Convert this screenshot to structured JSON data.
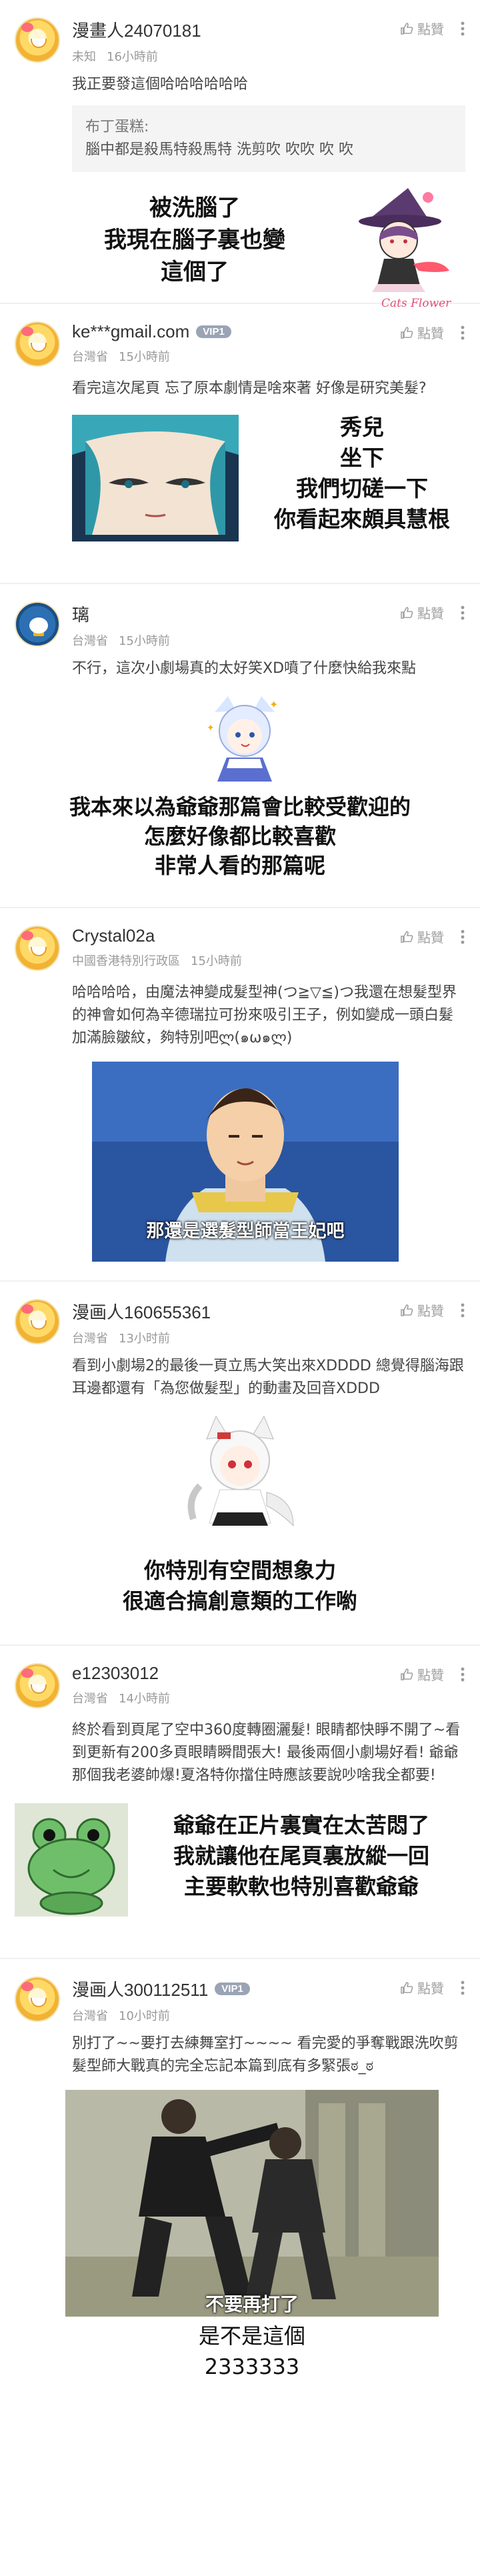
{
  "comments": [
    {
      "username": "漫畫人24070181",
      "vip": "",
      "location": "未知",
      "time": "16小時前",
      "like_label": "點贊",
      "text": "我正要發這個哈哈哈哈哈哈",
      "quote_author": "布丁蛋糕:",
      "quote_text": "腦中都是殺馬特殺馬特 洗剪吹 吹吹 吹 吹",
      "meme_caption": "被洗腦了\n我現在腦子裏也變\n這個了",
      "meme_watermark": "Cats Flower"
    },
    {
      "username": "ke***gmail.com",
      "vip": "VIP1",
      "location": "台灣省",
      "time": "15小時前",
      "like_label": "點贊",
      "text": "看完這次尾頁 忘了原本劇情是啥來著 好像是研究美髮?",
      "meme_caption": "秀兒\n坐下\n我們切磋一下\n你看起來頗具慧根"
    },
    {
      "username": "璃",
      "vip": "",
      "location": "台灣省",
      "time": "15小時前",
      "like_label": "點贊",
      "text": "不行，這次小劇場真的太好笑XD噴了什麼快給我來點",
      "meme_caption": "我本來以為爺爺那篇會比較受歡迎的\n怎麼好像都比較喜歡\n非常人看的那篇呢"
    },
    {
      "username": "Crystal02a",
      "vip": "",
      "location": "中國香港特別行政區",
      "time": "15小時前",
      "like_label": "點贊",
      "text": "哈哈哈哈，由魔法神變成髮型神(つ≧▽≦)つ我還在想髮型界的神會如何為辛德瑞拉可扮來吸引王子，例如變成一頭白髮加滿臉皺紋，夠特別吧ლ(๑ω๑ლ)",
      "meme_caption": "那還是選髮型師當王妃吧"
    },
    {
      "username": "漫画人160655361",
      "vip": "",
      "location": "台灣省",
      "time": "13小时前",
      "like_label": "點贊",
      "text": "看到小劇場2的最後一頁立馬大笑出來XDDDD 總覺得腦海跟耳邊都還有「為您做髮型」的動畫及回音XDDD",
      "meme_caption": "你特別有空間想象力\n很適合搞創意類的工作喲"
    },
    {
      "username": "e12303012",
      "vip": "",
      "location": "台灣省",
      "time": "14小時前",
      "like_label": "點贊",
      "text": "終於看到頁尾了空中360度轉圈灑髮! 眼睛都快睜不開了~看到更新有200多頁眼睛瞬間張大! 最後兩個小劇場好看! 爺爺那個我老婆帥爆!夏洛特你擋住時應該要說吵啥我全都要!",
      "meme_caption": "爺爺在正片裏實在太苦悶了\n我就讓他在尾頁裏放縱一回\n主要軟軟也特別喜歡爺爺"
    },
    {
      "username": "漫画人300112511",
      "vip": "VIP1",
      "location": "台灣省",
      "time": "10小时前",
      "like_label": "點贊",
      "text": "別打了~~要打去練舞室打~~~~ 看完愛的爭奪戰跟洗吹剪髮型師大戰真的完全忘記本篇到底有多緊張ಠ_ಠ",
      "meme_subtitle": "不要再打了",
      "meme_caption": "是不是這個\n2333333"
    }
  ]
}
